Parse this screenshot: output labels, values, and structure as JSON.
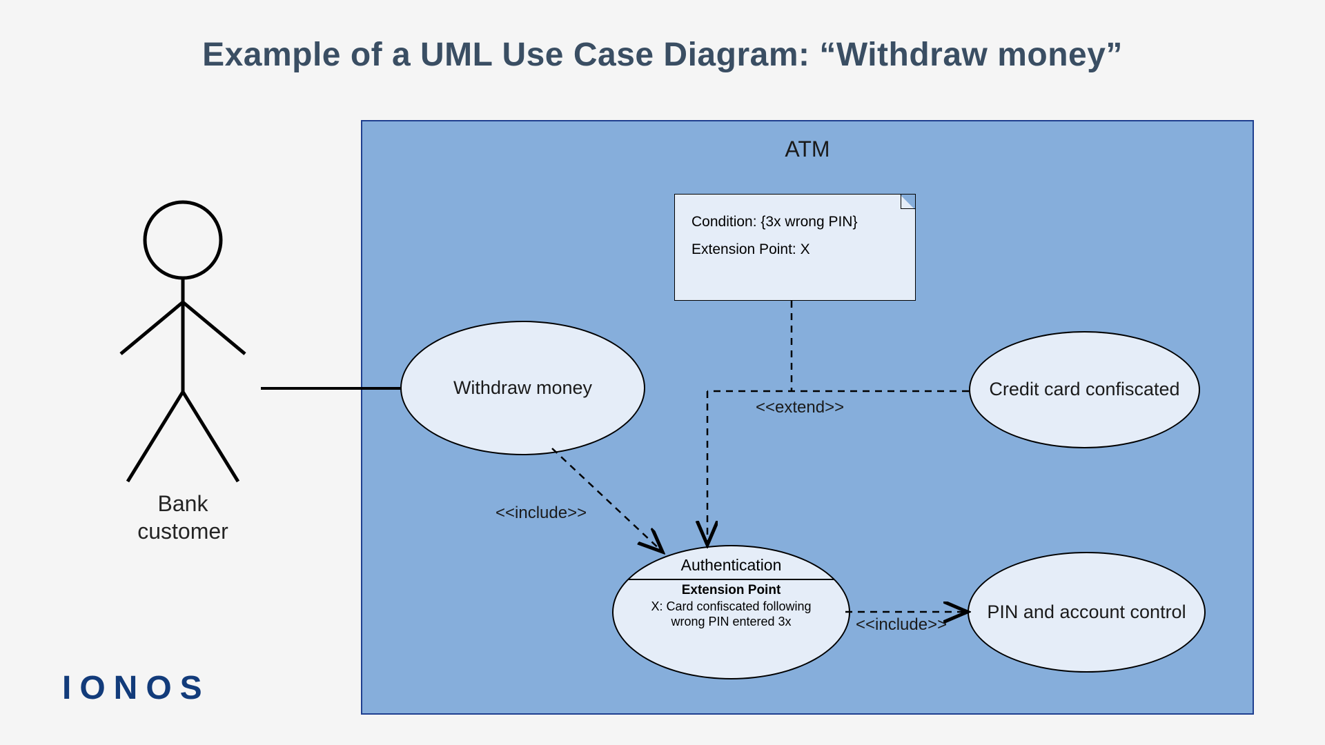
{
  "title": "Example of a UML Use Case Diagram: “Withdraw money”",
  "logo": "IONOS",
  "system": {
    "name": "ATM"
  },
  "actor": {
    "name": "Bank\ncustomer"
  },
  "usecases": {
    "withdraw": {
      "label": "Withdraw money"
    },
    "confiscated": {
      "label": "Credit card confiscated"
    },
    "pin_account": {
      "label": "PIN and account control"
    },
    "auth": {
      "name": "Authentication",
      "ext_header": "Extension Point",
      "ext_desc": "X: Card confiscated following wrong PIN entered 3x"
    }
  },
  "note": {
    "line1": "Condition: {3x wrong PIN}",
    "line2": "Extension Point: X"
  },
  "relations": {
    "include1": "<<include>>",
    "extend": "<<extend>>",
    "include2": "<<include>>"
  }
}
